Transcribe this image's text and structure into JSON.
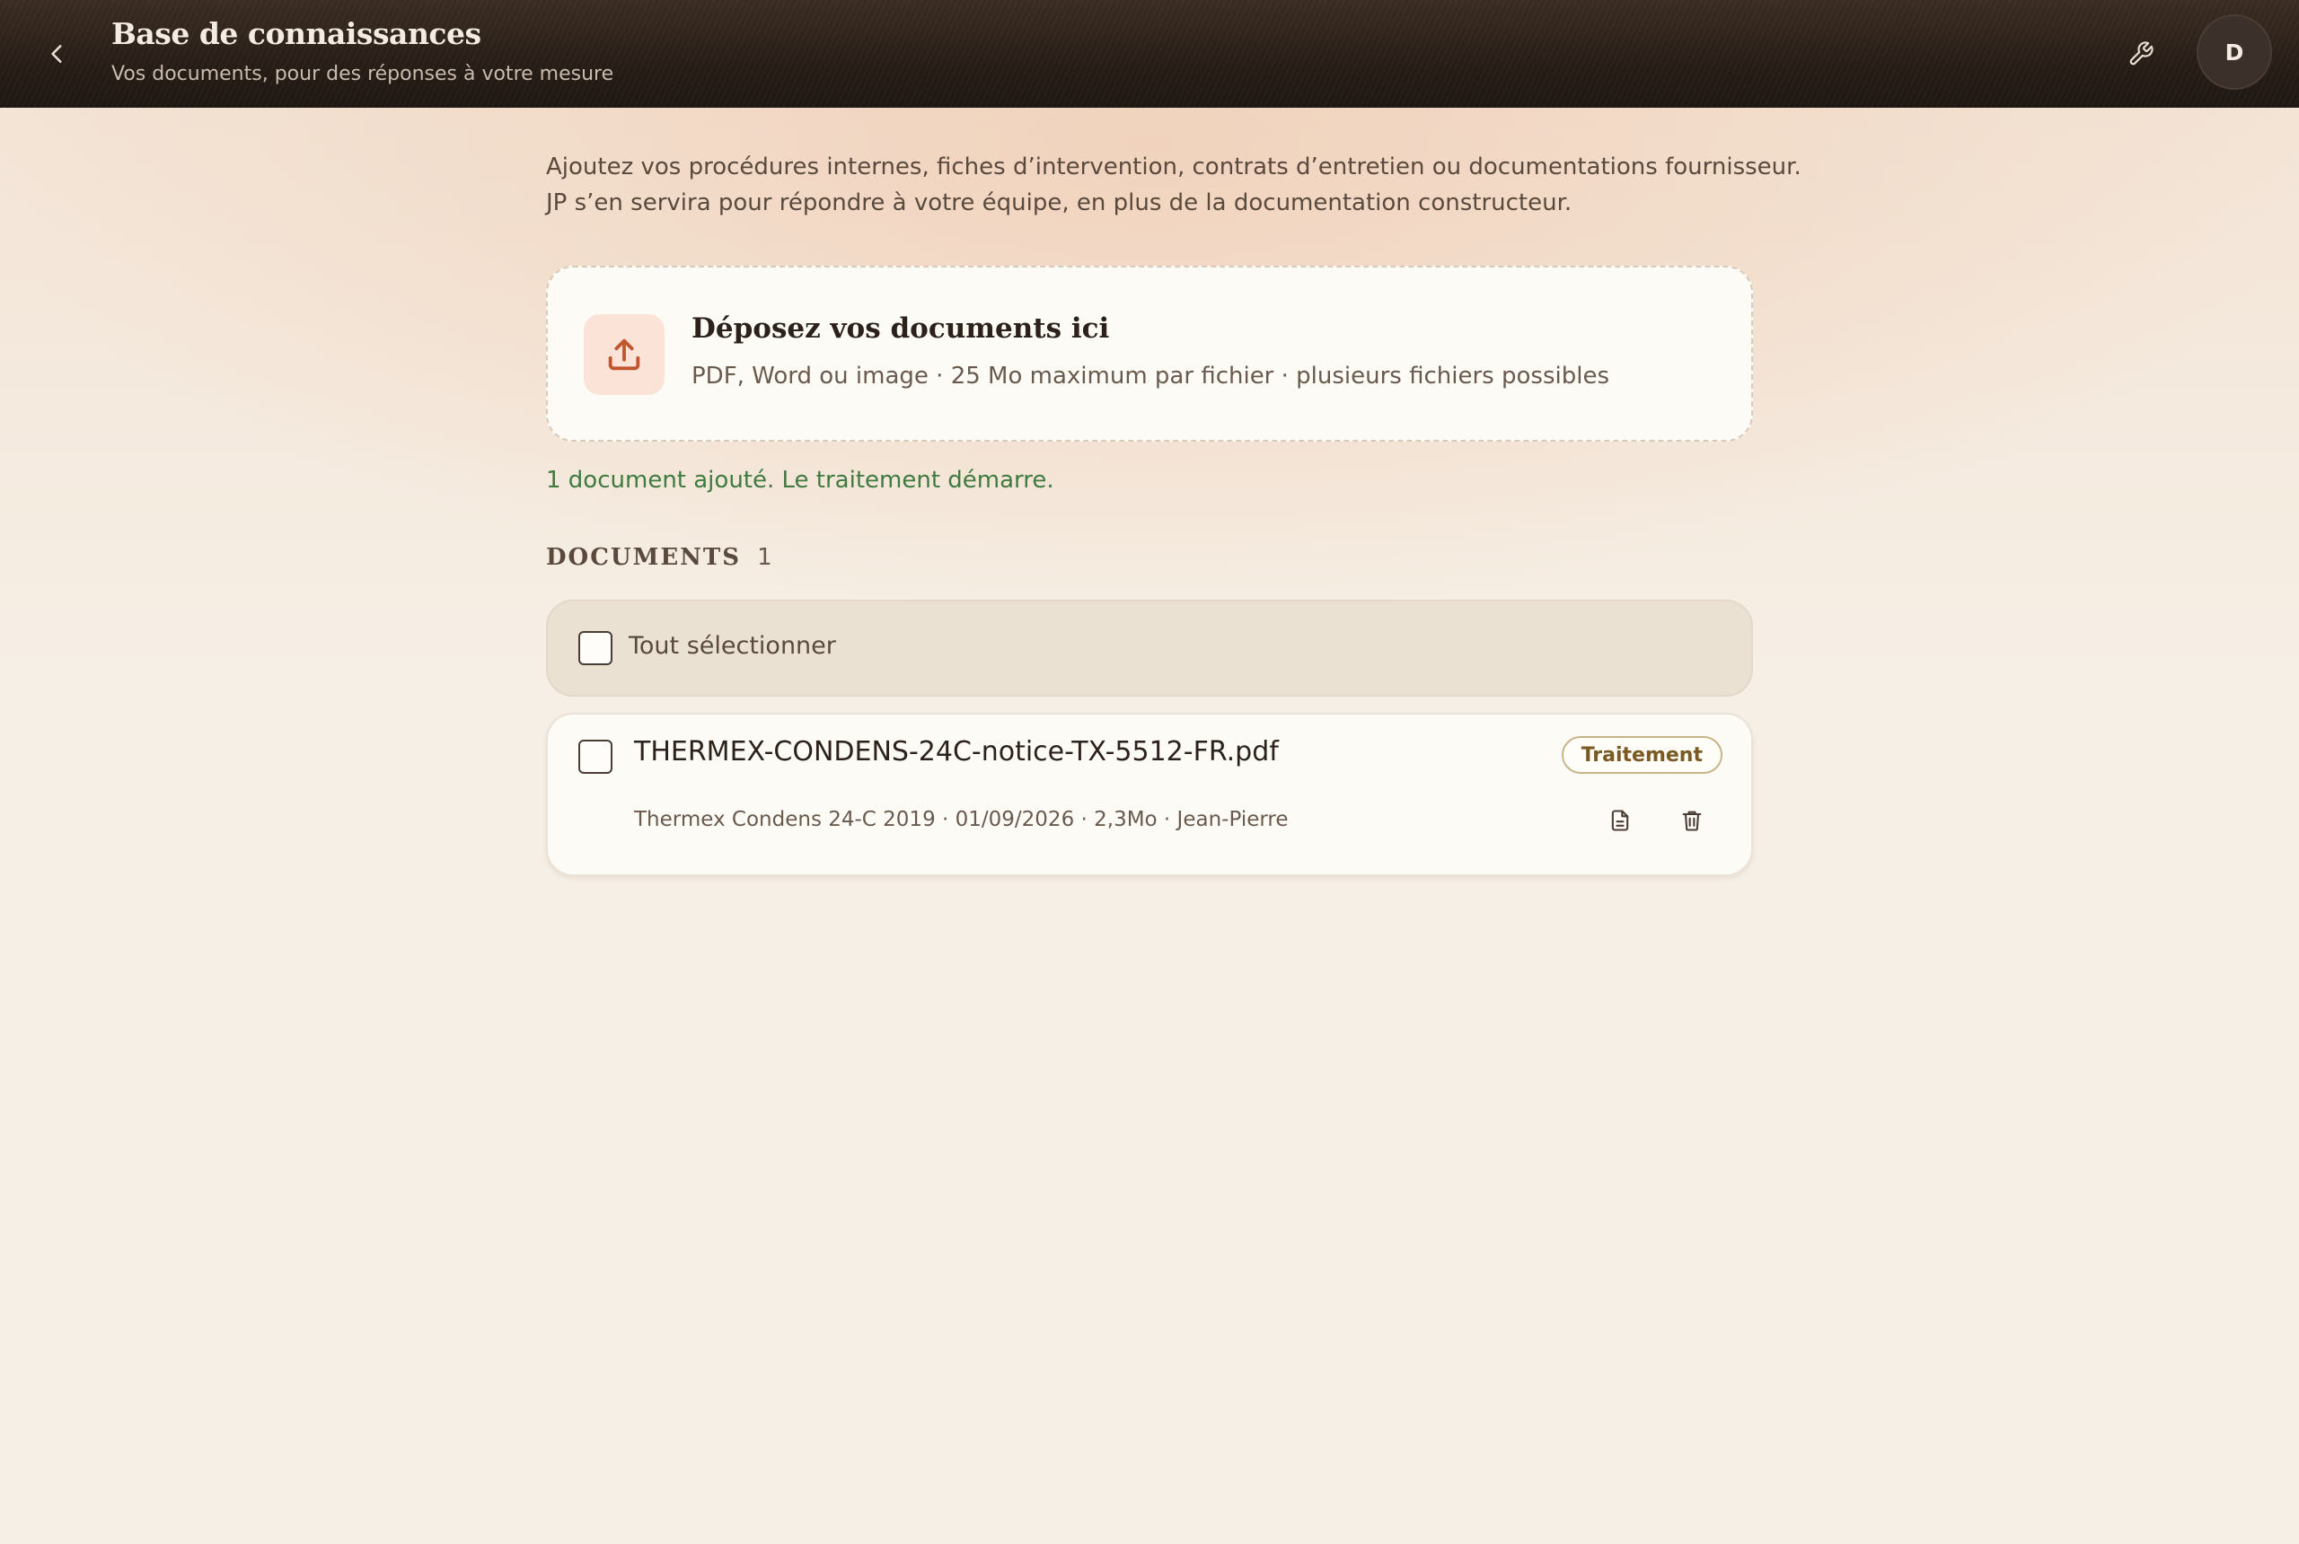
{
  "header": {
    "title": "Base de connaissances",
    "subtitle": "Vos documents, pour des réponses à votre mesure",
    "back_icon": "chevron-left-icon",
    "tools_icon": "wrench-icon",
    "avatar_initial": "D"
  },
  "intro": {
    "line1": "Ajoutez vos procédures internes, fiches d’intervention, contrats d’entretien ou documentations fournisseur.",
    "line2": "JP s’en servira pour répondre à votre équipe, en plus de la documentation constructeur."
  },
  "dropzone": {
    "icon": "upload-icon",
    "title": "Déposez vos documents ici",
    "hint": "PDF, Word ou image · 25 Mo maximum par fichier · plusieurs fichiers possibles"
  },
  "status_message": "1 document ajouté. Le traitement démarre.",
  "documents": {
    "section_title": "DOCUMENTS",
    "count": "1",
    "select_all_label": "Tout sélectionner",
    "items": [
      {
        "name": "THERMEX-CONDENS-24C-notice-TX-5512-FR.pdf",
        "status": "Traitement",
        "meta": "Thermex Condens 24-C 2019 · 01/09/2026 · 2,3Mo · Jean-Pierre",
        "view_icon": "document-icon",
        "delete_icon": "trash-icon"
      }
    ]
  },
  "colors": {
    "accent": "#c0552f",
    "success_text": "#3f7a3f",
    "header_bg": "#2a2019",
    "badge_border": "#c9b48a"
  }
}
